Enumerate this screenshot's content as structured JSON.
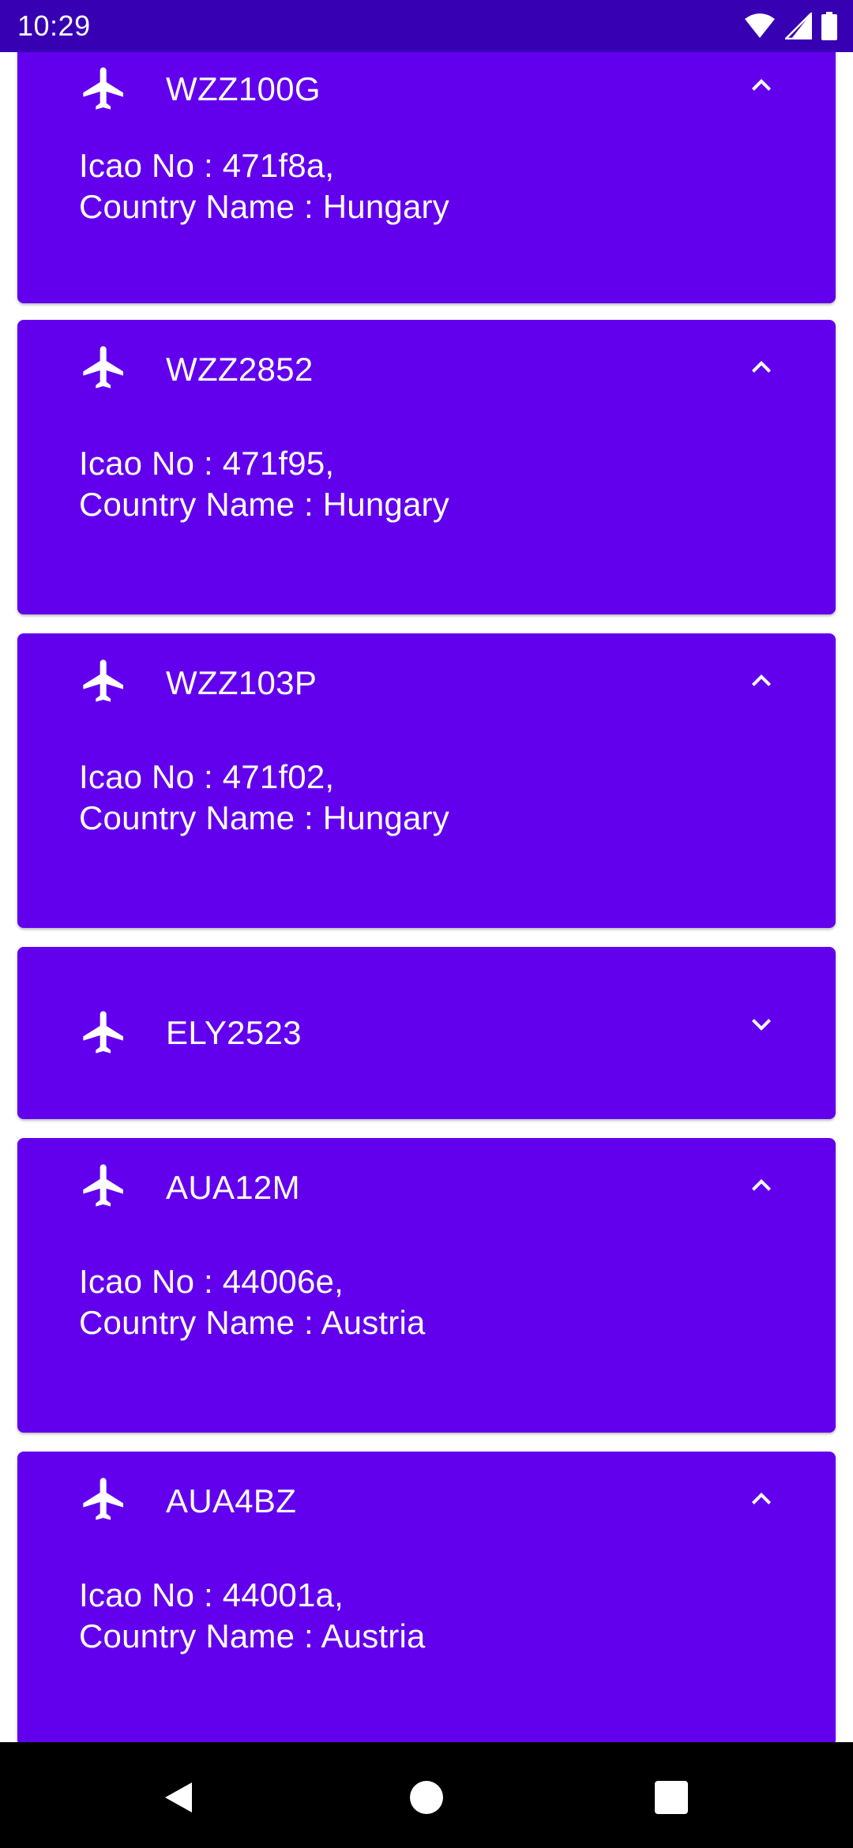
{
  "status_bar": {
    "time": "10:29",
    "icons": [
      "wifi-icon",
      "cellular-signal-icon",
      "battery-icon"
    ]
  },
  "colors": {
    "status_bar": "#3700b3",
    "card": "#6200ee",
    "text": "#ffffff",
    "nav_bar": "#000000"
  },
  "flights": [
    {
      "callsign": "WZZ100G",
      "expanded": true,
      "icao_line": "Icao No : 471f8a,",
      "country_line": "Country Name : Hungary"
    },
    {
      "callsign": "WZZ2852",
      "expanded": true,
      "icao_line": "Icao No : 471f95,",
      "country_line": "Country Name : Hungary"
    },
    {
      "callsign": "WZZ103P",
      "expanded": true,
      "icao_line": "Icao No : 471f02,",
      "country_line": "Country Name : Hungary"
    },
    {
      "callsign": "ELY2523",
      "expanded": false
    },
    {
      "callsign": "AUA12M",
      "expanded": true,
      "icao_line": "Icao No : 44006e,",
      "country_line": "Country Name : Austria"
    },
    {
      "callsign": "AUA4BZ",
      "expanded": true,
      "icao_line": "Icao No : 44001a,",
      "country_line": "Country Name : Austria"
    }
  ],
  "nav_bar": {
    "buttons": [
      "back-icon",
      "home-icon",
      "recents-icon"
    ]
  }
}
